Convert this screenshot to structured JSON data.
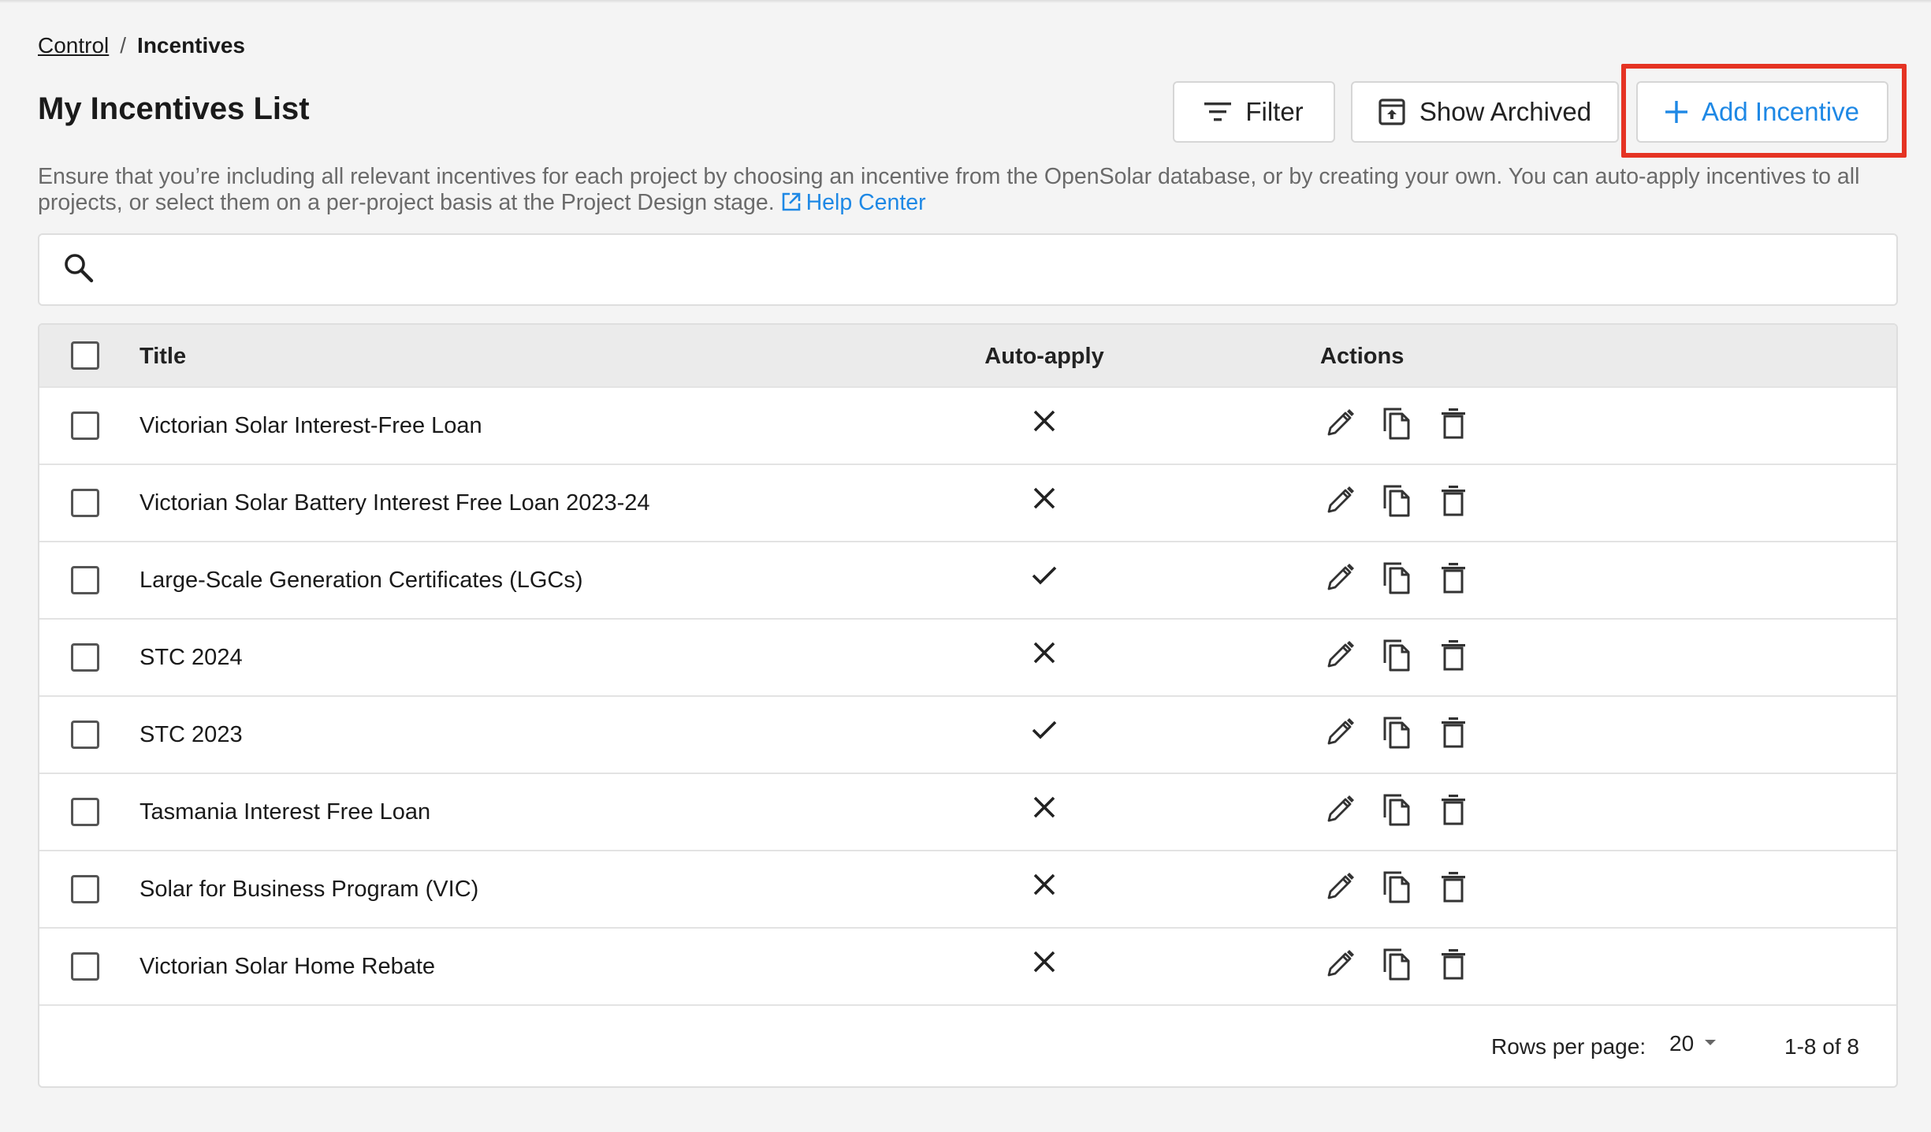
{
  "breadcrumb": {
    "parent": "Control",
    "separator": "/",
    "current": "Incentives"
  },
  "header": {
    "title": "My Incentives List",
    "filter_label": "Filter",
    "show_archived_label": "Show Archived",
    "add_label": "Add Incentive"
  },
  "description": {
    "text": "Ensure that you’re including all relevant incentives for each project by choosing an incentive from the OpenSolar database, or by creating your own. You can auto-apply incentives to all projects, or select them on a per-project basis at the Project Design stage.",
    "help_link": "Help Center"
  },
  "search": {
    "placeholder": "",
    "value": ""
  },
  "table": {
    "columns": {
      "title": "Title",
      "auto_apply": "Auto-apply",
      "actions": "Actions"
    },
    "rows": [
      {
        "title": "Victorian Solar Interest-Free Loan",
        "auto_apply": false
      },
      {
        "title": "Victorian Solar Battery Interest Free Loan 2023-24",
        "auto_apply": false
      },
      {
        "title": "Large-Scale Generation Certificates (LGCs)",
        "auto_apply": true
      },
      {
        "title": "STC 2024",
        "auto_apply": false
      },
      {
        "title": "STC 2023",
        "auto_apply": true
      },
      {
        "title": "Tasmania Interest Free Loan",
        "auto_apply": false
      },
      {
        "title": "Solar for Business Program (VIC)",
        "auto_apply": false
      },
      {
        "title": "Victorian Solar Home Rebate",
        "auto_apply": false
      }
    ]
  },
  "pagination": {
    "rows_per_page_label": "Rows per page:",
    "rows_per_page": "20",
    "range": "1-8 of 8"
  },
  "icons": {
    "filter": "filter-icon",
    "archive": "archive-icon",
    "add": "plus-icon",
    "external_link": "external-link-icon",
    "search": "search-icon",
    "edit": "pencil-icon",
    "copy": "copy-icon",
    "delete": "trash-icon",
    "yes": "check-icon",
    "no": "close-icon",
    "dropdown": "caret-down-icon"
  },
  "colors": {
    "accent": "#1e88e5",
    "highlight": "#e53323",
    "background": "#f4f4f4"
  }
}
